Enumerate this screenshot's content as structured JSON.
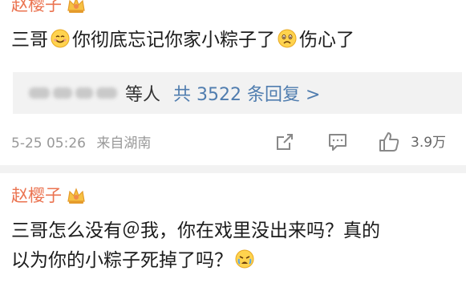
{
  "comment1": {
    "username": "赵樱子",
    "text_a": "三哥",
    "text_b": "你彻底忘记你家小粽子了",
    "text_c": "伤心了",
    "replies": {
      "who": "等人",
      "count": "共 3522 条回复 >"
    },
    "time": "5-25 05:26",
    "source": "来自湖南",
    "likes": "3.9万"
  },
  "comment2": {
    "username": "赵樱子",
    "line1": "三哥怎么没有＠我，你在戏里没出来吗？真的",
    "line2": "以为你的小粽子死掉了吗？"
  },
  "colors": {
    "username": "#eb7350",
    "link": "#507daf",
    "meta": "#999999",
    "reply_bg": "#f2f2f2"
  },
  "icons": [
    "crown-badge-icon",
    "smile-emoji-icon",
    "sad-emoji-icon",
    "share-icon",
    "comment-icon",
    "like-icon",
    "cry-emoji-icon"
  ]
}
